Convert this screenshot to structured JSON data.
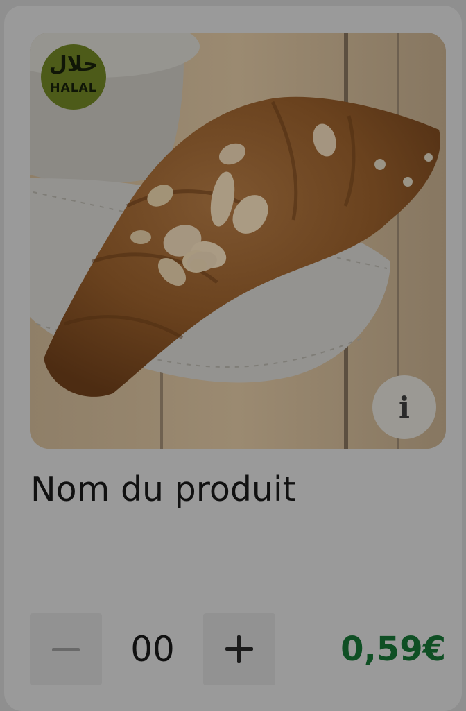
{
  "card": {
    "image_alt": "Croissant aux amandes",
    "halal_badge": {
      "arabic": "حلال",
      "latin": "HALAL"
    },
    "info_button_label": "i",
    "product_name": "Nom du produit",
    "quantity": "00",
    "price": "0,59€",
    "accent_price_color": "#0f4f24"
  }
}
